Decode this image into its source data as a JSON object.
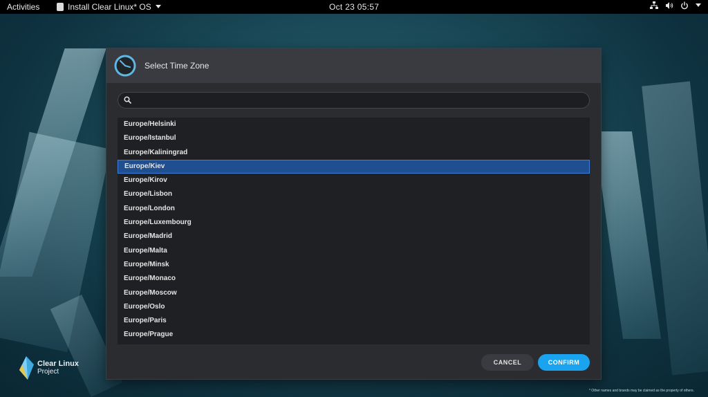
{
  "topbar": {
    "activities": "Activities",
    "app_name": "Install Clear Linux* OS",
    "app_menu_icon": "chevron-down-icon",
    "clock": "Oct 23  05:57",
    "tray_icons": [
      "network-icon",
      "volume-icon",
      "power-icon",
      "chevron-down-icon"
    ]
  },
  "dialog": {
    "title": "Select Time Zone",
    "icon": "clock-icon",
    "search": {
      "value": "",
      "placeholder": ""
    },
    "timezones": [
      "Europe/Helsinki",
      "Europe/Istanbul",
      "Europe/Kaliningrad",
      "Europe/Kiev",
      "Europe/Kirov",
      "Europe/Lisbon",
      "Europe/London",
      "Europe/Luxembourg",
      "Europe/Madrid",
      "Europe/Malta",
      "Europe/Minsk",
      "Europe/Monaco",
      "Europe/Moscow",
      "Europe/Oslo",
      "Europe/Paris",
      "Europe/Prague"
    ],
    "selected_timezone": "Europe/Kiev",
    "cancel_label": "CANCEL",
    "confirm_label": "CONFIRM"
  },
  "branding": {
    "line1": "Clear Linux",
    "line2": "Project",
    "footnote": "* Other names and brands may be claimed as the property of others."
  },
  "colors": {
    "accent": "#1aa4ef",
    "selection": "#1f4f91",
    "dialog_bg": "#2b2c30",
    "header_bg": "#3a3b40"
  }
}
